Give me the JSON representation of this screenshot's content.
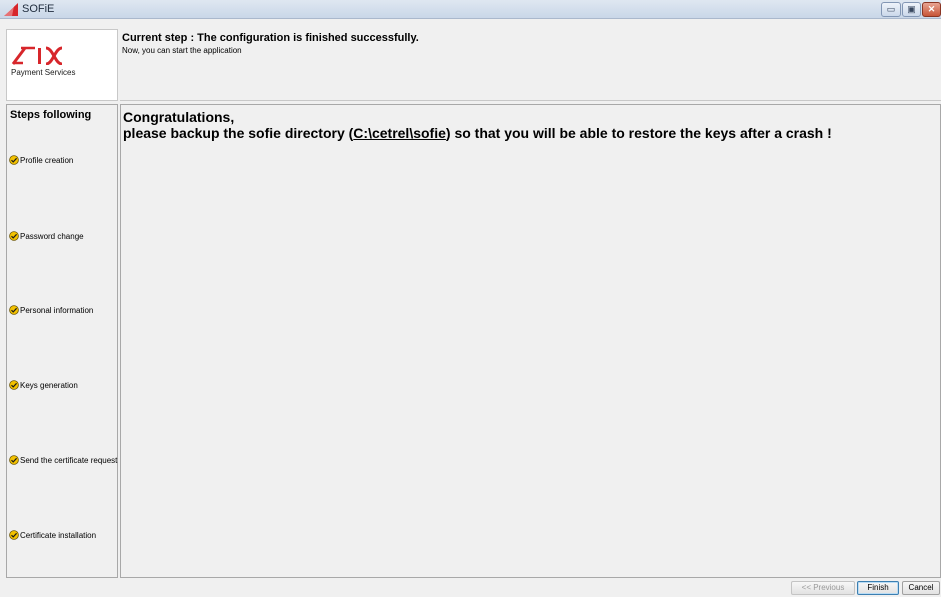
{
  "window": {
    "title": "SOFiE"
  },
  "window_controls": {
    "minimize": "▭",
    "maximize": "▣",
    "close": "✕"
  },
  "logo": {
    "brand": "SIX",
    "caption": "Payment Services"
  },
  "header": {
    "current_step": "Current step :  The configuration is finished successfully.",
    "subtext": "Now, you can start the application"
  },
  "steps": {
    "title": "Steps following",
    "items": [
      {
        "label": "Profile creation",
        "icon": "ok-icon"
      },
      {
        "label": "Password change",
        "icon": "ok-icon"
      },
      {
        "label": "Personal information",
        "icon": "ok-icon"
      },
      {
        "label": "Keys generation",
        "icon": "ok-icon"
      },
      {
        "label": "Send the certificate request",
        "icon": "ok-icon"
      },
      {
        "label": "Certificate installation",
        "icon": "ok-icon"
      }
    ]
  },
  "content": {
    "line1": "Congratulations,",
    "line2_prefix": "please backup the sofie directory (",
    "line2_link": "C:\\cetrel\\sofie",
    "line2_suffix": ") so that you will be able to restore the keys after a crash !"
  },
  "buttons": {
    "previous": "<< Previous",
    "finish": "Finish",
    "cancel": "Cancel"
  },
  "colors": {
    "brand_red": "#d7262b",
    "ok_yellow": "#f3c200"
  }
}
